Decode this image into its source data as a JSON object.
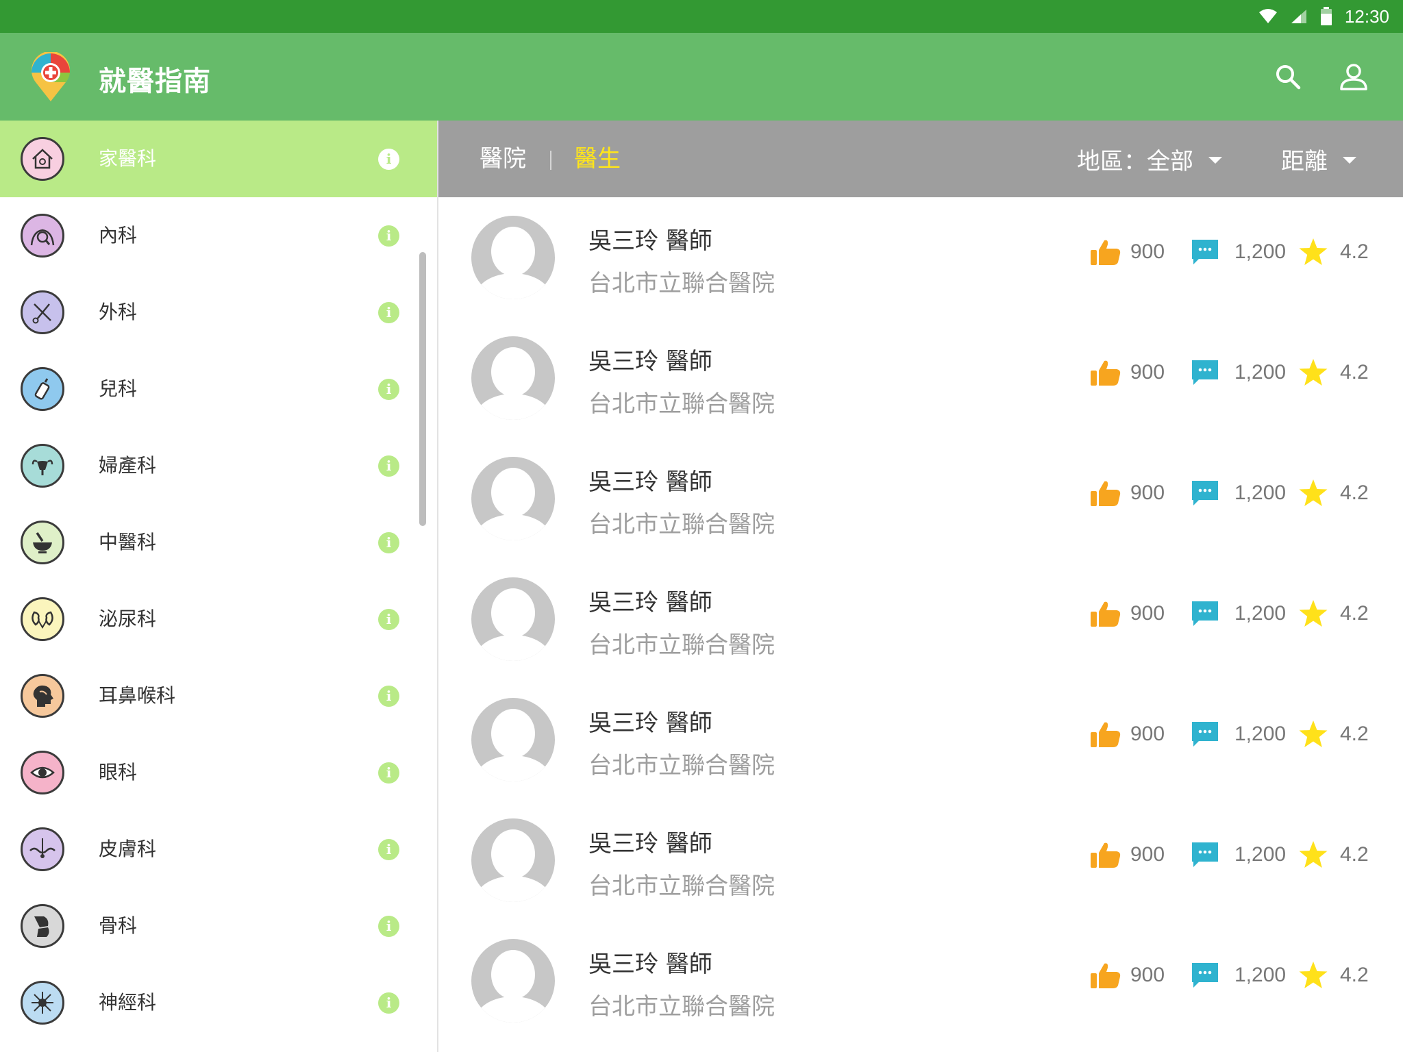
{
  "status_bar": {
    "time": "12:30"
  },
  "app_bar": {
    "title": "就醫指南",
    "icons": [
      "app-logo-icon",
      "search-icon",
      "account-icon"
    ]
  },
  "sidebar": {
    "items": [
      {
        "label": "家醫科",
        "icon": "house-doctor-icon",
        "bg": "#f8cfe0",
        "active": true
      },
      {
        "label": "內科",
        "icon": "body-magnifier-icon",
        "bg": "#dcb6e4"
      },
      {
        "label": "外科",
        "icon": "scissors-scalpel-icon",
        "bg": "#c7c1ec"
      },
      {
        "label": "兒科",
        "icon": "baby-bottle-icon",
        "bg": "#8fc9ee"
      },
      {
        "label": "婦產科",
        "icon": "uterus-icon",
        "bg": "#a7dcd8"
      },
      {
        "label": "中醫科",
        "icon": "mortar-pestle-icon",
        "bg": "#dff0c8"
      },
      {
        "label": "泌尿科",
        "icon": "kidney-icon",
        "bg": "#fbf5bd"
      },
      {
        "label": "耳鼻喉科",
        "icon": "head-profile-icon",
        "bg": "#f6c89c"
      },
      {
        "label": "眼科",
        "icon": "eye-icon",
        "bg": "#f5b3c9"
      },
      {
        "label": "皮膚科",
        "icon": "skin-layer-icon",
        "bg": "#d6c4ec"
      },
      {
        "label": "骨科",
        "icon": "bone-joint-icon",
        "bg": "#d8d8d8"
      },
      {
        "label": "神經科",
        "icon": "neuron-icon",
        "bg": "#bcdcf2"
      }
    ],
    "info_glyph": "i"
  },
  "filter_bar": {
    "tabs": [
      {
        "label": "醫院",
        "active": false
      },
      {
        "label": "醫生",
        "active": true
      }
    ],
    "region_dropdown": "地區：全部",
    "distance_dropdown": "距離"
  },
  "doctors": [
    {
      "name": "吳三玲 醫師",
      "hospital": "台北市立聯合醫院",
      "likes": "900",
      "comments": "1,200",
      "rating": "4.2"
    },
    {
      "name": "吳三玲 醫師",
      "hospital": "台北市立聯合醫院",
      "likes": "900",
      "comments": "1,200",
      "rating": "4.2"
    },
    {
      "name": "吳三玲 醫師",
      "hospital": "台北市立聯合醫院",
      "likes": "900",
      "comments": "1,200",
      "rating": "4.2"
    },
    {
      "name": "吳三玲 醫師",
      "hospital": "台北市立聯合醫院",
      "likes": "900",
      "comments": "1,200",
      "rating": "4.2"
    },
    {
      "name": "吳三玲 醫師",
      "hospital": "台北市立聯合醫院",
      "likes": "900",
      "comments": "1,200",
      "rating": "4.2"
    },
    {
      "name": "吳三玲 醫師",
      "hospital": "台北市立聯合醫院",
      "likes": "900",
      "comments": "1,200",
      "rating": "4.2"
    },
    {
      "name": "吳三玲 醫師",
      "hospital": "台北市立聯合醫院",
      "likes": "900",
      "comments": "1,200",
      "rating": "4.2"
    }
  ],
  "colors": {
    "status_bar": "#339933",
    "app_bar": "#66bb6a",
    "sidebar_active": "#b9ea87",
    "filter_bar": "#9e9e9e",
    "tab_active": "#ffe51a",
    "like": "#f7a51f",
    "comment": "#2fb3cf",
    "star": "#ffe11a"
  }
}
